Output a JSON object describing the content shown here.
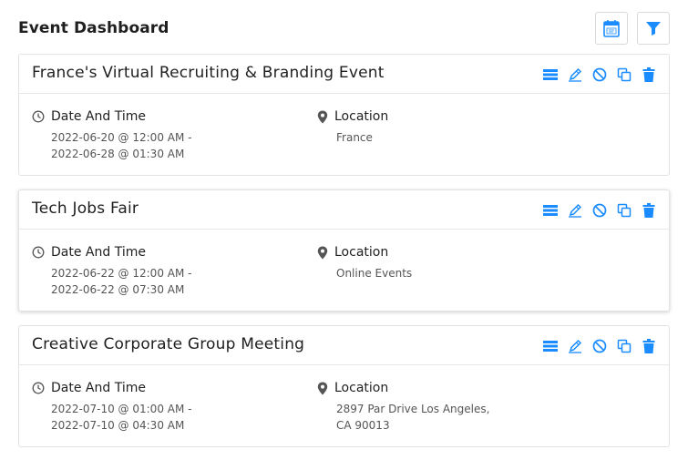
{
  "page": {
    "title": "Event Dashboard"
  },
  "header_buttons": {
    "ical_icon": "ical-calendar-icon",
    "filter_icon": "filter-funnel-icon"
  },
  "labels": {
    "date_time": "Date And Time",
    "location": "Location"
  },
  "colors": {
    "accent": "#1a8cff",
    "icon_gray": "#555555"
  },
  "events": [
    {
      "title": "France's Virtual Recruiting & Branding Event",
      "date_line1": "2022-06-20 @ 12:00 AM -",
      "date_line2": "2022-06-28 @ 01:30 AM",
      "location_line1": "France",
      "location_line2": ""
    },
    {
      "title": "Tech Jobs Fair",
      "date_line1": "2022-06-22 @ 12:00 AM -",
      "date_line2": "2022-06-22 @ 07:30 AM",
      "location_line1": "Online Events",
      "location_line2": ""
    },
    {
      "title": "Creative Corporate Group Meeting",
      "date_line1": "2022-07-10 @ 01:00 AM -",
      "date_line2": "2022-07-10 @ 04:30 AM",
      "location_line1": "2897 Par Drive Los Angeles,",
      "location_line2": "CA 90013"
    }
  ]
}
